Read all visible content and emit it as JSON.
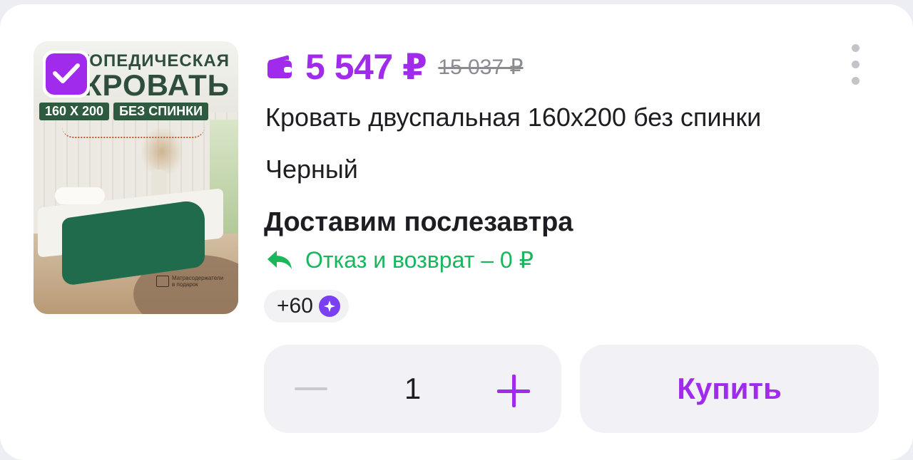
{
  "product_image": {
    "title_line1": "ОРТОПЕДИЧЕСКАЯ",
    "title_line2": "КРОВАТЬ",
    "tag1": "160 X 200",
    "tag2": "БЕЗ СПИНКИ",
    "gift_text_1": "Матрасодержатели",
    "gift_text_2": "в подарок"
  },
  "selected": true,
  "price": {
    "current": "5 547 ₽",
    "old": "15 037 ₽"
  },
  "product": {
    "name": "Кровать двуспальная 160х200 без спинки",
    "color": "Черный"
  },
  "delivery": "Доставим послезавтра",
  "return_policy": "Отказ и возврат – 0 ₽",
  "bonus": "+60",
  "quantity": "1",
  "buy_label": "Купить",
  "colors": {
    "accent": "#a02bec",
    "green": "#19b65c",
    "bonus": "#7b3ff2"
  },
  "icons": {
    "wallet": "wallet-icon",
    "return": "return-arrow-icon",
    "more": "more-vertical-icon",
    "bonus": "sparkle-icon",
    "check": "checkmark-icon"
  }
}
